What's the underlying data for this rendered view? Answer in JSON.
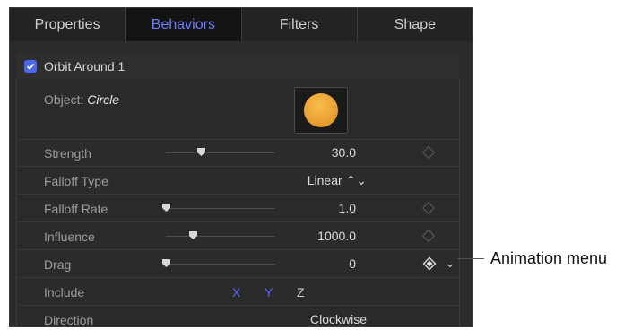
{
  "tabs": [
    "Properties",
    "Behaviors",
    "Filters",
    "Shape"
  ],
  "behavior": {
    "title": "Orbit Around 1",
    "enabled": true
  },
  "object": {
    "label": "Object:",
    "value": "Circle"
  },
  "params": [
    {
      "label": "Strength",
      "value": "30.0",
      "slider_fraction": 0.32
    },
    {
      "label": "Falloff Type",
      "value": "Linear ⌃⌄"
    },
    {
      "label": "Falloff Rate",
      "value": "1.0",
      "slider_fraction": 0.0
    },
    {
      "label": "Influence",
      "value": "1000.0",
      "slider_fraction": 0.25
    },
    {
      "label": "Drag",
      "value": "0",
      "slider_fraction": 0.0
    },
    {
      "label": "Include",
      "axes": [
        "X",
        "Y",
        "Z"
      ]
    },
    {
      "label": "Direction",
      "value": "Clockwise ⌃⌄"
    }
  ],
  "callout": "Animation menu",
  "colors": {
    "accent": "#6a7cff",
    "axis_x": "#5267ff",
    "axis_y": "#5267ff",
    "axis_z": "#cfcfcf"
  }
}
